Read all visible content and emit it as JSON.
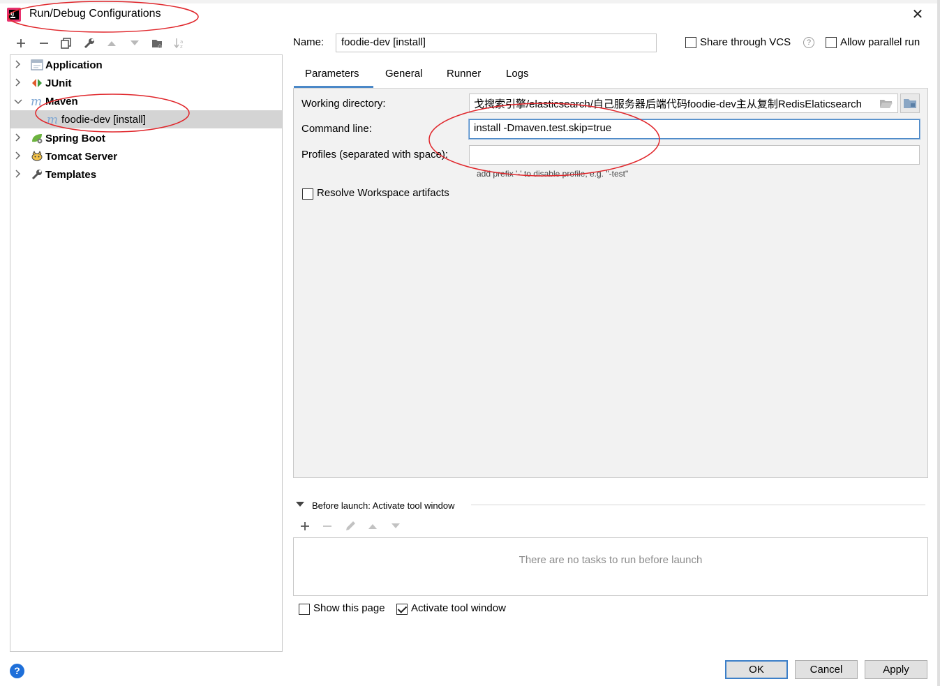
{
  "window": {
    "title": "Run/Debug Configurations",
    "close_glyph": "✕"
  },
  "toolbar": {
    "buttons": [
      {
        "name": "add-icon",
        "glyph": "+"
      },
      {
        "name": "remove-icon",
        "glyph": "−"
      },
      {
        "name": "copy-icon",
        "glyph": "⧉"
      },
      {
        "name": "wrench-icon",
        "glyph": "🔧"
      },
      {
        "name": "move-up-icon",
        "glyph": "▲"
      },
      {
        "name": "move-down-icon",
        "glyph": "▼"
      },
      {
        "name": "new-folder-icon",
        "glyph": "▤"
      },
      {
        "name": "sort-icon",
        "glyph": "↓a"
      }
    ]
  },
  "tree": {
    "items": [
      {
        "label": "Application",
        "icon": "application-icon",
        "expanded": false
      },
      {
        "label": "JUnit",
        "icon": "junit-icon",
        "expanded": false
      },
      {
        "label": "Maven",
        "icon": "maven-icon",
        "expanded": true
      },
      {
        "label": "foodie-dev [install]",
        "icon": "maven-icon",
        "child": true,
        "selected": true
      },
      {
        "label": "Spring Boot",
        "icon": "spring-boot-icon",
        "expanded": false
      },
      {
        "label": "Tomcat Server",
        "icon": "tomcat-icon",
        "expanded": false
      },
      {
        "label": "Templates",
        "icon": "wrench-icon",
        "expanded": false
      }
    ]
  },
  "config": {
    "name_label": "Name:",
    "name_value": "foodie-dev [install]",
    "share_vcs_label": "Share through VCS",
    "share_vcs_checked": false,
    "allow_parallel_label": "Allow parallel run",
    "allow_parallel_checked": false,
    "tabs": [
      {
        "label": "Parameters",
        "active": true
      },
      {
        "label": "General",
        "active": false
      },
      {
        "label": "Runner",
        "active": false
      },
      {
        "label": "Logs",
        "active": false
      }
    ]
  },
  "parameters": {
    "working_dir_label": "Working directory:",
    "working_dir_value": "戈搜索引擎/elasticsearch/自己服务器后端代码foodie-dev主从复制RedisElaticsearch",
    "command_line_label": "Command line:",
    "command_line_value": "install -Dmaven.test.skip=true",
    "profiles_label": "Profiles (separated with space):",
    "profiles_value": "",
    "profiles_hint": "add prefix '-' to disable profile, e.g. \"-test\"",
    "resolve_workspace_label": "Resolve Workspace artifacts",
    "resolve_workspace_checked": false
  },
  "before_launch": {
    "header": "Before launch: Activate tool window",
    "empty_text": "There are no tasks to run before launch",
    "toolbar": [
      {
        "name": "add-task-icon",
        "glyph": "+",
        "enabled": true
      },
      {
        "name": "remove-task-icon",
        "glyph": "−",
        "enabled": false
      },
      {
        "name": "edit-task-icon",
        "glyph": "✎",
        "enabled": false
      },
      {
        "name": "task-up-icon",
        "glyph": "▲",
        "enabled": false
      },
      {
        "name": "task-down-icon",
        "glyph": "▼",
        "enabled": false
      }
    ]
  },
  "footer": {
    "show_page_label": "Show this page",
    "show_page_checked": false,
    "activate_tool_label": "Activate tool window",
    "activate_tool_checked": true,
    "ok_label": "OK",
    "cancel_label": "Cancel",
    "apply_label": "Apply",
    "help_glyph": "?"
  },
  "colors": {
    "accent": "#4a88c7",
    "selection": "#d4d4d4",
    "annotation": "#e0262b"
  }
}
